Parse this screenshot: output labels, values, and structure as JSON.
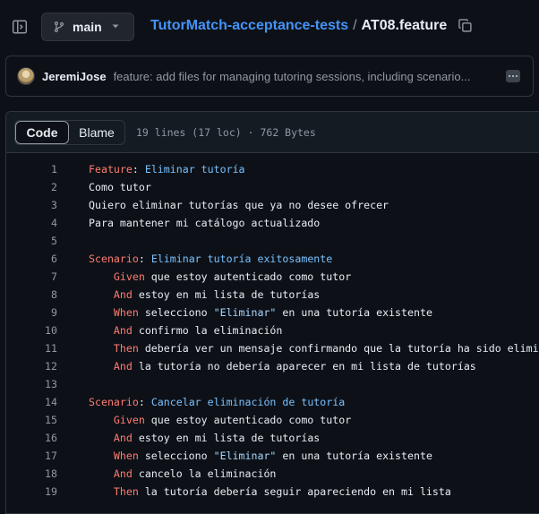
{
  "header": {
    "branch": "main",
    "repo": "TutorMatch-acceptance-tests",
    "separator": "/",
    "file": "AT08.feature"
  },
  "commit": {
    "author": "JeremiJose",
    "message": "feature: add files for managing tutoring sessions, including scenario..."
  },
  "file_view": {
    "tabs": [
      "Code",
      "Blame"
    ],
    "active_tab": "Code",
    "meta": "19 lines (17 loc) · 762 Bytes"
  },
  "code_lines": [
    {
      "n": "1",
      "parts": [
        {
          "c": "kw",
          "t": "Feature"
        },
        {
          "c": "tx",
          "t": ": "
        },
        {
          "c": "nm",
          "t": "Eliminar tutoría"
        }
      ]
    },
    {
      "n": "2",
      "parts": [
        {
          "c": "tx",
          "t": "Como tutor"
        }
      ]
    },
    {
      "n": "3",
      "parts": [
        {
          "c": "tx",
          "t": "Quiero eliminar tutorías que ya no desee ofrecer"
        }
      ]
    },
    {
      "n": "4",
      "parts": [
        {
          "c": "tx",
          "t": "Para mantener mi catálogo actualizado"
        }
      ]
    },
    {
      "n": "5",
      "parts": []
    },
    {
      "n": "6",
      "parts": [
        {
          "c": "kw",
          "t": "Scenario"
        },
        {
          "c": "tx",
          "t": ": "
        },
        {
          "c": "nm",
          "t": "Eliminar tutoría exitosamente"
        }
      ]
    },
    {
      "n": "7",
      "parts": [
        {
          "c": "tx",
          "t": "    "
        },
        {
          "c": "kw",
          "t": "Given"
        },
        {
          "c": "tx",
          "t": " que estoy autenticado como tutor"
        }
      ]
    },
    {
      "n": "8",
      "parts": [
        {
          "c": "tx",
          "t": "    "
        },
        {
          "c": "kw",
          "t": "And"
        },
        {
          "c": "tx",
          "t": " estoy en mi lista de tutorías"
        }
      ]
    },
    {
      "n": "9",
      "parts": [
        {
          "c": "tx",
          "t": "    "
        },
        {
          "c": "kw",
          "t": "When"
        },
        {
          "c": "tx",
          "t": " selecciono "
        },
        {
          "c": "st",
          "t": "\"Eliminar\""
        },
        {
          "c": "tx",
          "t": " en una tutoría existente"
        }
      ]
    },
    {
      "n": "10",
      "parts": [
        {
          "c": "tx",
          "t": "    "
        },
        {
          "c": "kw",
          "t": "And"
        },
        {
          "c": "tx",
          "t": " confirmo la eliminación"
        }
      ]
    },
    {
      "n": "11",
      "parts": [
        {
          "c": "tx",
          "t": "    "
        },
        {
          "c": "kw",
          "t": "Then"
        },
        {
          "c": "tx",
          "t": " debería ver un mensaje confirmando que la tutoría ha sido eliminada"
        }
      ]
    },
    {
      "n": "12",
      "parts": [
        {
          "c": "tx",
          "t": "    "
        },
        {
          "c": "kw",
          "t": "And"
        },
        {
          "c": "tx",
          "t": " la tutoría no debería aparecer en mi lista de tutorías"
        }
      ]
    },
    {
      "n": "13",
      "parts": []
    },
    {
      "n": "14",
      "parts": [
        {
          "c": "kw",
          "t": "Scenario"
        },
        {
          "c": "tx",
          "t": ": "
        },
        {
          "c": "nm",
          "t": "Cancelar eliminación de tutoría"
        }
      ]
    },
    {
      "n": "15",
      "parts": [
        {
          "c": "tx",
          "t": "    "
        },
        {
          "c": "kw",
          "t": "Given"
        },
        {
          "c": "tx",
          "t": " que estoy autenticado como tutor"
        }
      ]
    },
    {
      "n": "16",
      "parts": [
        {
          "c": "tx",
          "t": "    "
        },
        {
          "c": "kw",
          "t": "And"
        },
        {
          "c": "tx",
          "t": " estoy en mi lista de tutorías"
        }
      ]
    },
    {
      "n": "17",
      "parts": [
        {
          "c": "tx",
          "t": "    "
        },
        {
          "c": "kw",
          "t": "When"
        },
        {
          "c": "tx",
          "t": " selecciono "
        },
        {
          "c": "st",
          "t": "\"Eliminar\""
        },
        {
          "c": "tx",
          "t": " en una tutoría existente"
        }
      ]
    },
    {
      "n": "18",
      "parts": [
        {
          "c": "tx",
          "t": "    "
        },
        {
          "c": "kw",
          "t": "And"
        },
        {
          "c": "tx",
          "t": " cancelo la eliminación"
        }
      ]
    },
    {
      "n": "19",
      "parts": [
        {
          "c": "tx",
          "t": "    "
        },
        {
          "c": "kw",
          "t": "Then"
        },
        {
          "c": "tx",
          "t": " la tutoría debería seguir apareciendo en mi lista"
        }
      ]
    }
  ],
  "icons": {
    "sidebar_toggle": "sidebar-expand-icon",
    "branch": "git-branch-icon",
    "caret": "triangle-down-icon",
    "copy": "copy-icon",
    "more": "kebab-horizontal-icon"
  },
  "colors": {
    "background": "#0d1117",
    "link": "#4493f8",
    "keyword": "#ff7b72",
    "name": "#79c0ff",
    "string": "#a5d6ff"
  }
}
